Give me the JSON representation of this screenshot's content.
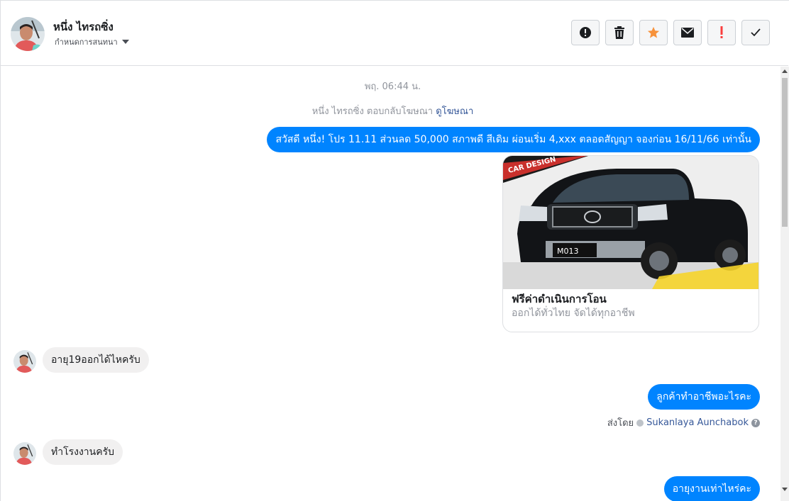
{
  "header": {
    "name": "หนึ่ง ไทรถซิ่ง",
    "subtitle": "กำหนดการสนทนา",
    "actions": [
      {
        "icon": "alert-circle-icon"
      },
      {
        "icon": "trash-icon"
      },
      {
        "icon": "star-icon",
        "color": "#f7923b"
      },
      {
        "icon": "envelope-icon"
      },
      {
        "icon": "exclamation-icon",
        "color": "#fa3e3e"
      },
      {
        "icon": "check-icon"
      }
    ]
  },
  "thread": {
    "timestamp": "พฤ. 06:44 น.",
    "ad_reply_note": "หนึ่ง ไทรถซิ่ง ตอบกลับโฆษณา",
    "ad_link": "ดูโฆษณา",
    "messages": [
      {
        "from": "page",
        "text": "สวัสดี หนึ่ง! โปร 11.11 ส่วนลด 50,000 สภาพดี สีเดิม ผ่อนเริ่ม 4,xxx ตลอดสัญญา จองก่อน 16/11/66 เท่านั้น"
      },
      {
        "from": "user",
        "text": "อายุ19ออกได้ไหครับ"
      },
      {
        "from": "page",
        "text": "ลูกค้าทำอาชีพอะไรคะ"
      },
      {
        "from": "user",
        "text": "ทำโรงงานครับ"
      },
      {
        "from": "page",
        "text": "อายุงานเท่าไหร่คะ"
      }
    ],
    "card": {
      "title": "ฟรีค่าดำเนินการโอน",
      "subtitle": "ออกได้ทั่วไทย จัดได้ทุกอาชีพ",
      "image_banner": "CAR DESIGN",
      "plate": "M013"
    },
    "sent_by_label": "ส่งโดย",
    "sent_by_name": "Sukanlaya Aunchabok"
  },
  "colors": {
    "accent": "#0084ff",
    "incoming_bubble": "#f1f0f0",
    "link": "#365899"
  }
}
